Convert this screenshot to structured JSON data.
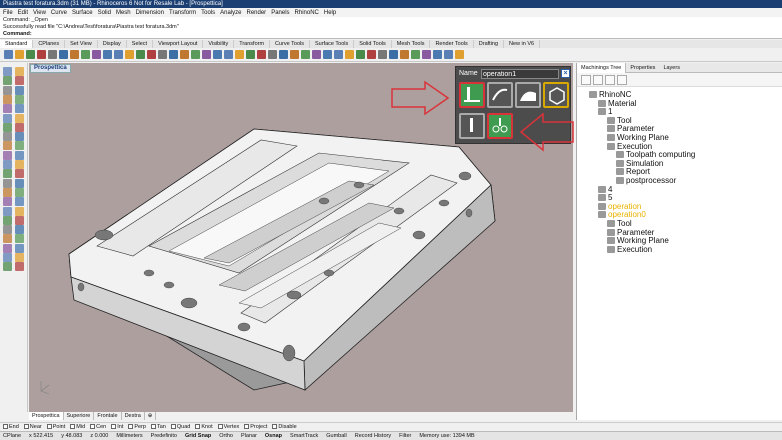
{
  "window": {
    "title": "Piastra test foratura.3dm (31 MB) - Rhinoceros 6 Not for Resale Lab - [Prospettica]"
  },
  "menu": [
    "File",
    "Edit",
    "View",
    "Curve",
    "Surface",
    "Solid",
    "Mesh",
    "Dimension",
    "Transform",
    "Tools",
    "Analyze",
    "Render",
    "Panels",
    "RhinoNC",
    "Help"
  ],
  "command": {
    "lines": [
      "Command: _Open",
      "Successfully read file \"C:\\Andrea\\Test\\foratura\\Piastra test foratura.3dm\""
    ],
    "prompt": "Command:"
  },
  "toolbar_tabs": [
    "Standard",
    "CPlanes",
    "Set View",
    "Display",
    "Select",
    "Viewport Layout",
    "Visibility",
    "Transform",
    "Curve Tools",
    "Surface Tools",
    "Solid Tools",
    "Mesh Tools",
    "Render Tools",
    "Drafting",
    "New in V6"
  ],
  "viewport": {
    "label": "Prospettica"
  },
  "viewport_tabs": [
    "Prospettica",
    "Superiore",
    "Frontale",
    "Destra"
  ],
  "operation_dialog": {
    "name_label": "Name",
    "name_value": "operation1",
    "close_icon": "close-icon"
  },
  "panel": {
    "tabs": [
      "Machinings Tree",
      "Properties",
      "Layers"
    ],
    "tree": [
      {
        "label": "RhinoNC",
        "depth": 0
      },
      {
        "label": "Material",
        "depth": 1
      },
      {
        "label": "1",
        "depth": 1
      },
      {
        "label": "Tool",
        "depth": 2
      },
      {
        "label": "Parameter",
        "depth": 2
      },
      {
        "label": "Working Plane",
        "depth": 2
      },
      {
        "label": "Execution",
        "depth": 2
      },
      {
        "label": "Toolpath computing",
        "depth": 3
      },
      {
        "label": "Simulation",
        "depth": 3
      },
      {
        "label": "Report",
        "depth": 3
      },
      {
        "label": "postprocessor",
        "depth": 3
      },
      {
        "label": "4",
        "depth": 1
      },
      {
        "label": "5",
        "depth": 1
      },
      {
        "label": "operation",
        "depth": 1
      },
      {
        "label": "operation0",
        "depth": 1
      },
      {
        "label": "Tool",
        "depth": 2
      },
      {
        "label": "Parameter",
        "depth": 2
      },
      {
        "label": "Working Plane",
        "depth": 2
      },
      {
        "label": "Execution",
        "depth": 2
      }
    ]
  },
  "osnaps": [
    "End",
    "Near",
    "Point",
    "Mid",
    "Cen",
    "Int",
    "Perp",
    "Tan",
    "Quad",
    "Knot",
    "Vertex",
    "Project",
    "Disable"
  ],
  "status": {
    "cplane": "CPlane",
    "x": "x 522.415",
    "y": "y 48.083",
    "z": "z 0.000",
    "units": "Millimeters",
    "layer": "Predefinito",
    "grid_snap": "Grid Snap",
    "ortho": "Ortho",
    "planar": "Planar",
    "osnap": "Osnap",
    "smarttrack": "SmartTrack",
    "gumball": "Gumball",
    "record_history": "Record History",
    "filter": "Filter",
    "memory": "Memory use: 1394 MB"
  },
  "colors": {
    "viewport_bg": "#ae9f9f",
    "accent_red": "#d9333a",
    "green_button": "#3f9b50",
    "tree_yellow": "#e9b200"
  }
}
